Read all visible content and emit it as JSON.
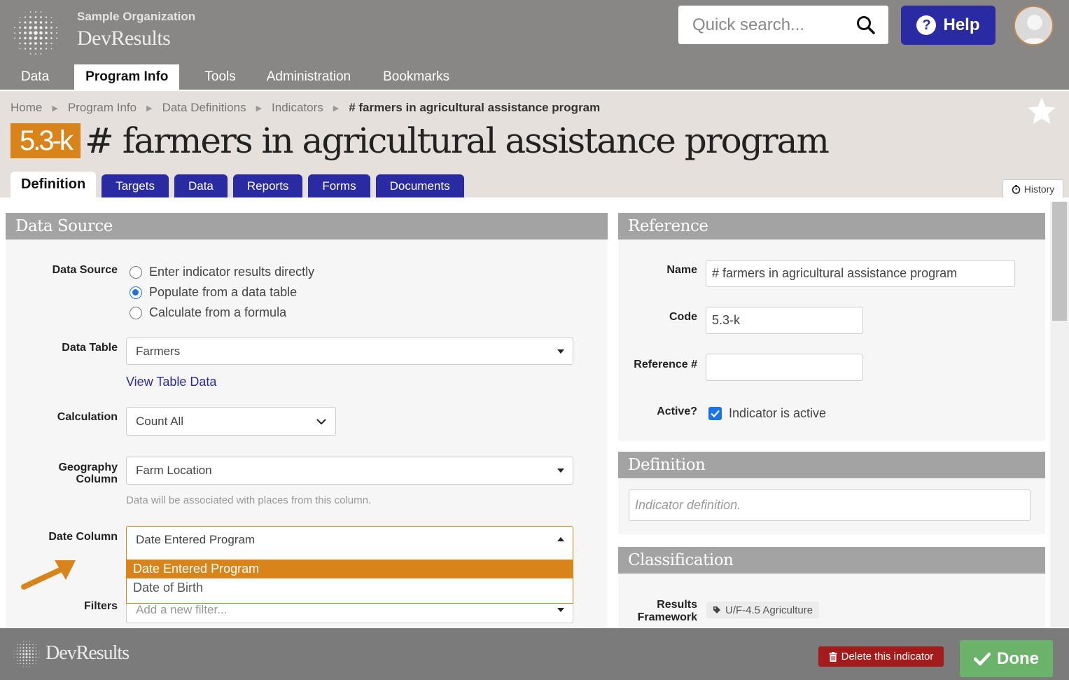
{
  "header": {
    "org_name": "Sample Organization",
    "app_name": "DevResults",
    "search_placeholder": "Quick search...",
    "help_label": "Help"
  },
  "nav": {
    "data": "Data",
    "program_info": "Program Info",
    "tools": "Tools",
    "administration": "Administration",
    "bookmarks": "Bookmarks"
  },
  "breadcrumb": [
    "Home",
    "Program Info",
    "Data Definitions",
    "Indicators",
    "# farmers in agricultural assistance program"
  ],
  "indicator": {
    "code": "5.3-k",
    "title": "# farmers in agricultural assistance program"
  },
  "tabs": {
    "definition": "Definition",
    "targets": "Targets",
    "data": "Data",
    "reports": "Reports",
    "forms": "Forms",
    "documents": "Documents"
  },
  "history_label": "History",
  "data_source": {
    "heading": "Data Source",
    "source_label": "Data Source",
    "options": [
      "Enter indicator results directly",
      "Populate from a data table",
      "Calculate from a formula"
    ],
    "data_table_label": "Data Table",
    "data_table_value": "Farmers",
    "view_table_link": "View Table Data",
    "calculation_label": "Calculation",
    "calculation_value": "Count All",
    "geography_label_1": "Geography",
    "geography_label_2": "Column",
    "geography_value": "Farm Location",
    "geography_help": "Data will be associated with places from this column.",
    "date_label": "Date Column",
    "date_value": "Date Entered Program",
    "date_options": [
      "Date Entered Program",
      "Date of Birth"
    ],
    "filters_label": "Filters",
    "filters_placeholder": "Add a new filter..."
  },
  "reference": {
    "heading": "Reference",
    "name_label": "Name",
    "name_value": "# farmers in agricultural assistance program",
    "code_label": "Code",
    "code_value": "5.3-k",
    "refnum_label": "Reference #",
    "refnum_value": "",
    "active_label": "Active?",
    "active_text": "Indicator is active"
  },
  "definition": {
    "heading": "Definition",
    "placeholder": "Indicator definition."
  },
  "classification": {
    "heading": "Classification",
    "rf_label_1": "Results",
    "rf_label_2": "Framework",
    "rf_tag": "U/F-4.5 Agriculture"
  },
  "footer": {
    "logo_text": "DevResults",
    "delete_label": "Delete this indicator",
    "done_label": "Done"
  },
  "colors": {
    "header_bg": "#888786",
    "accent_orange": "#d9841b",
    "tab_blue": "#2a2aa3",
    "done_green": "#6bb36b",
    "delete_red": "#a31b1b"
  }
}
